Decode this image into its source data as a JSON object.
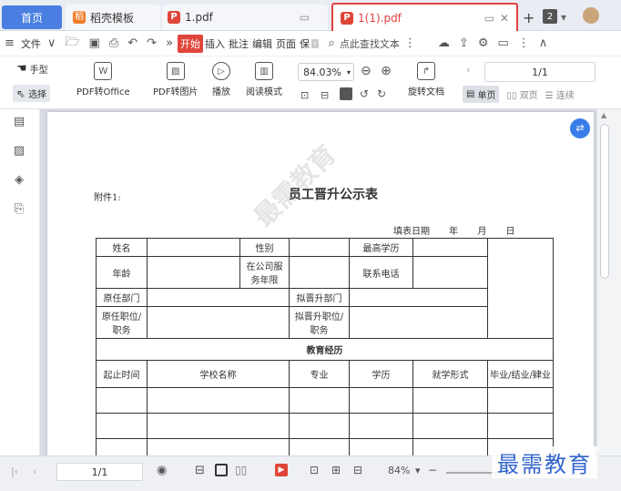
{
  "tabs": {
    "home": "首页",
    "template": "稻壳模板",
    "pdf1": "1.pdf",
    "pdf2": "1(1).pdf",
    "badge": "2"
  },
  "menu": {
    "file": "文件",
    "start": "开始",
    "insert": "插入",
    "annotate": "批注",
    "edit": "编辑",
    "page": "页面",
    "protect": "保",
    "search": "点此查找文本"
  },
  "toolbar": {
    "hand": "手型",
    "select": "选择",
    "pdf_to_office": "PDF转Office",
    "pdf_to_image": "PDF转图片",
    "play": "播放",
    "read_mode": "阅读模式",
    "zoom": "84.03%",
    "rotate": "旋转文档",
    "page": "1/1",
    "single": "单页",
    "double": "双页",
    "continuous": "连续"
  },
  "document": {
    "attachment": "附件1:",
    "title": "员工晋升公示表",
    "date_line": "填表日期 年 月 日",
    "name": "姓名",
    "gender": "性别",
    "education_level": "最高学历",
    "age": "年龄",
    "tenure": "在公司服务年限",
    "phone": "联系电话",
    "orig_dept": "原任部门",
    "new_dept": "拟晋升部门",
    "orig_pos": "原任职位/职务",
    "new_pos": "拟晋升职位/职务",
    "edu_history": "教育经历",
    "period": "起止时间",
    "school": "学校名称",
    "major": "专业",
    "degree": "学历",
    "study_form": "就学形式",
    "graduation": "毕业/结业/肄业"
  },
  "status": {
    "page": "1/1",
    "zoom": "84%"
  },
  "brand": "最需教育"
}
